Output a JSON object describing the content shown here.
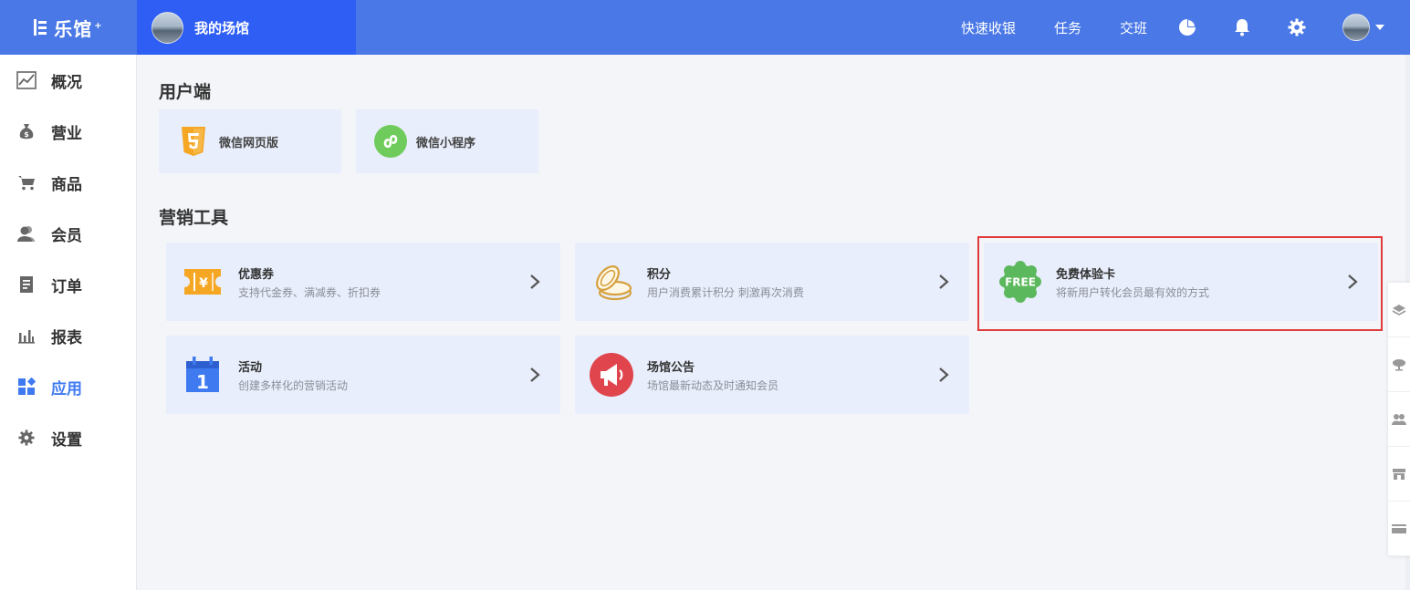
{
  "app": {
    "logo_text": "乐馆",
    "logo_sup": "+",
    "venue_name": "我的场馆"
  },
  "header": {
    "links": [
      "快速收银",
      "任务",
      "交班"
    ],
    "icons": [
      "pie-chart-icon",
      "bell-icon",
      "gear-icon"
    ]
  },
  "sidebar": {
    "items": [
      {
        "label": "概况",
        "icon": "trend-chart-icon",
        "active": false
      },
      {
        "label": "营业",
        "icon": "money-bag-icon",
        "active": false
      },
      {
        "label": "商品",
        "icon": "cart-icon",
        "active": false
      },
      {
        "label": "会员",
        "icon": "user-icon",
        "active": false
      },
      {
        "label": "订单",
        "icon": "receipt-icon",
        "active": false
      },
      {
        "label": "报表",
        "icon": "bar-chart-icon",
        "active": false
      },
      {
        "label": "应用",
        "icon": "apps-icon",
        "active": true
      },
      {
        "label": "设置",
        "icon": "gear-icon",
        "active": false
      }
    ]
  },
  "client_section": {
    "title": "用户端",
    "cards": [
      {
        "label": "微信网页版",
        "icon": "html5-icon"
      },
      {
        "label": "微信小程序",
        "icon": "mini-program-icon"
      }
    ]
  },
  "marketing_section": {
    "title": "营销工具",
    "tools": [
      {
        "name": "优惠券",
        "desc": "支持代金券、满减券、折扣券",
        "icon": "coupon-icon"
      },
      {
        "name": "积分",
        "desc": "用户消费累计积分 刺激再次消费",
        "icon": "coins-icon"
      },
      {
        "name": "免费体验卡",
        "desc": "将新用户转化会员最有效的方式",
        "icon": "free-badge-icon",
        "badge_text": "FREE"
      },
      {
        "name": "活动",
        "desc": "创建多样化的营销活动",
        "icon": "calendar-icon",
        "calendar_day": "1"
      },
      {
        "name": "场馆公告",
        "desc": "场馆最新动态及时通知会员",
        "icon": "megaphone-icon"
      }
    ]
  },
  "colors": {
    "header_blue": "#4a78e6",
    "venue_blue": "#2f5ef5",
    "active_blue": "#3f7af0",
    "card_bg": "#e8eefb",
    "highlight_red": "#e03b3b"
  }
}
